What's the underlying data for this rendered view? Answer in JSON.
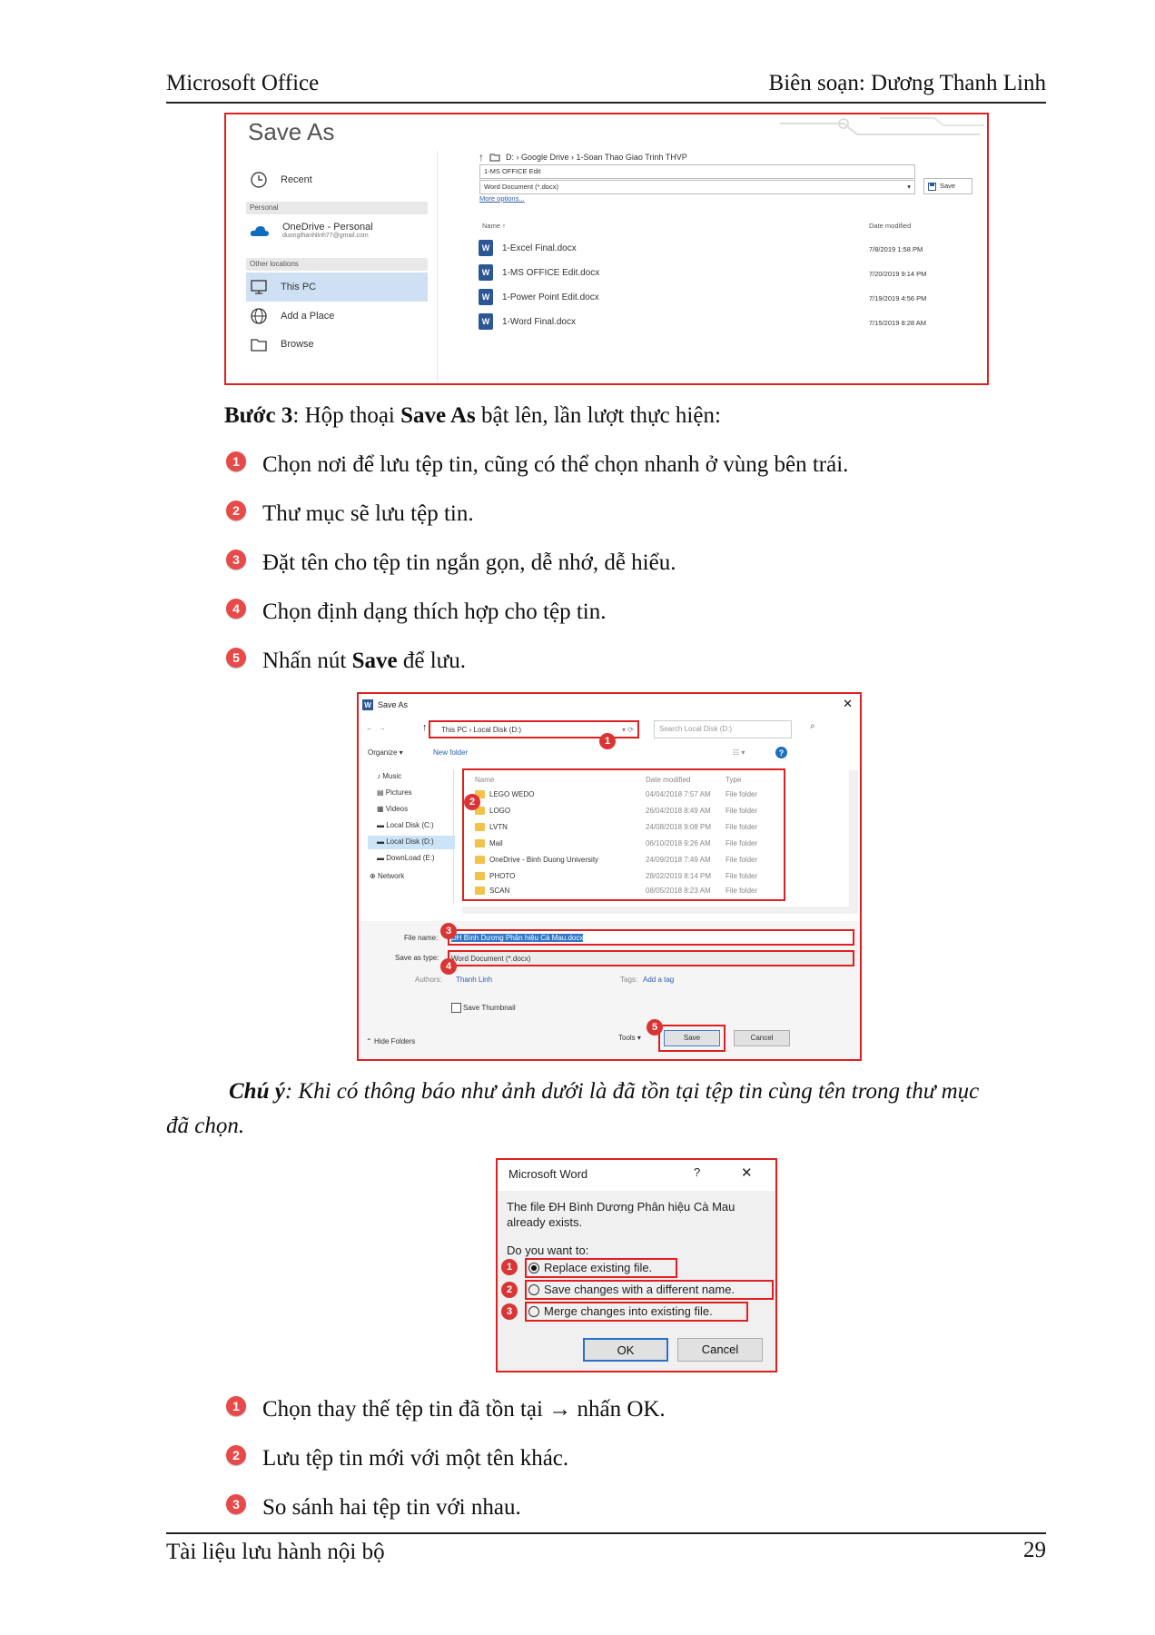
{
  "header": {
    "left": "Microsoft Office",
    "right": "Biên soạn: Dương Thanh Linh"
  },
  "footer": {
    "left": "Tài liệu lưu hành nội bộ",
    "page_number": "29"
  },
  "figure1": {
    "title": "Save As",
    "left_pane": {
      "recent": "Recent",
      "section_personal": "Personal",
      "onedrive": "OneDrive - Personal",
      "onedrive_email": "duongthanhlinh77@gmail.com",
      "section_other": "Other locations",
      "this_pc": "This PC",
      "add_place": "Add a Place",
      "browse": "Browse"
    },
    "breadcrumb": "D: › Google Drive › 1-Soan Thao Giao Trinh THVP",
    "filename": "1-MS OFFICE Edit",
    "filetype": "Word Document (*.docx)",
    "more_options": "More options...",
    "save_label": "Save",
    "col_name": "Name ↑",
    "col_date": "Date modified",
    "files": [
      {
        "name": "1-Excel Final.docx",
        "date": "7/8/2019 1:58 PM"
      },
      {
        "name": "1-MS OFFICE Edit.docx",
        "date": "7/20/2019 9:14 PM"
      },
      {
        "name": "1-Power Point Edit.docx",
        "date": "7/19/2019 4:56 PM"
      },
      {
        "name": "1-Word Final.docx",
        "date": "7/15/2019 8:28 AM"
      }
    ]
  },
  "step3": {
    "label": "Bước 3",
    "text_a": ": Hộp thoại ",
    "bold": "Save As",
    "text_b": " bật lên, lần lượt thực hiện:"
  },
  "steps": [
    {
      "badge": "1",
      "text": "Chọn nơi để lưu tệp tin, cũng có thể chọn nhanh ở vùng bên trái."
    },
    {
      "badge": "2",
      "text": "Thư mục sẽ lưu tệp tin."
    },
    {
      "badge": "3",
      "text": "Đặt tên cho tệp tin ngắn gọn, dễ nhớ, dễ hiểu."
    },
    {
      "badge": "4",
      "text": "Chọn định dạng thích hợp cho tệp tin."
    },
    {
      "badge": "5",
      "text_a": "Nhấn nút ",
      "bold": "Save",
      "text_b": " để lưu."
    }
  ],
  "figure2": {
    "title": "Save As",
    "path": "This PC › Local Disk (D:)",
    "search_placeholder": "Search Local Disk (D:)",
    "organize": "Organize ▾",
    "new_folder": "New folder",
    "nav": [
      "Music",
      "Pictures",
      "Videos",
      "Local Disk (C:)",
      "Local Disk (D:)",
      "DownLoad (E:)",
      "Network"
    ],
    "col_name": "Name",
    "col_date": "Date modified",
    "col_type": "Type",
    "folders": [
      {
        "name": "LEGO WEDO",
        "date": "04/04/2018 7:57 AM",
        "type": "File folder"
      },
      {
        "name": "LOGO",
        "date": "26/04/2018 8:49 AM",
        "type": "File folder"
      },
      {
        "name": "LVTN",
        "date": "24/08/2018 9:08 PM",
        "type": "File folder"
      },
      {
        "name": "Mail",
        "date": "06/10/2018 9:26 AM",
        "type": "File folder"
      },
      {
        "name": "OneDrive - Binh Duong University",
        "date": "24/09/2018 7:49 AM",
        "type": "File folder"
      },
      {
        "name": "PHOTO",
        "date": "28/02/2019 8:14 PM",
        "type": "File folder"
      },
      {
        "name": "SCAN",
        "date": "08/05/2018 8:23 AM",
        "type": "File folder"
      }
    ],
    "filename_label": "File name:",
    "filename_value": "ĐH Bình Dương Phân hiệu Cà Mau.docx",
    "savetype_label": "Save as type:",
    "savetype_value": "Word Document (*.docx)",
    "authors_label": "Authors:",
    "authors_value": "Thanh Linh",
    "tags_label": "Tags:",
    "tags_value": "Add a tag",
    "thumbnail": "Save Thumbnail",
    "hide_folders": "Hide Folders",
    "tools": "Tools",
    "save": "Save",
    "cancel": "Cancel",
    "badges": [
      "1",
      "2",
      "3",
      "4",
      "5"
    ]
  },
  "note": {
    "label": "Chú ý",
    "text": ": Khi có thông báo như ảnh dưới là đã tồn tại tệp tin cùng tên trong thư mục",
    "text2": "đã chọn."
  },
  "figure3": {
    "title": "Microsoft Word",
    "help": "?",
    "close": "✕",
    "message_1": "The file ĐH Bình Dương Phân hiệu Cà Mau",
    "message_2": "already exists.",
    "question": "Do you want to:",
    "options": [
      "Replace existing file.",
      "Save changes with a different name.",
      "Merge changes into existing file."
    ],
    "ok": "OK",
    "cancel": "Cancel",
    "badges": [
      "1",
      "2",
      "3"
    ]
  },
  "bottom_steps": [
    {
      "badge": "1",
      "text": "Chọn thay thế tệp tin đã tồn tại → nhấn OK."
    },
    {
      "badge": "2",
      "text": "Lưu tệp tin mới với một tên khác."
    },
    {
      "badge": "3",
      "text": "So sánh hai tệp tin với nhau."
    }
  ],
  "colors": {
    "highlight_red": "#e02020",
    "badge_red": "#e84a4a",
    "word_blue": "#2b5797"
  }
}
